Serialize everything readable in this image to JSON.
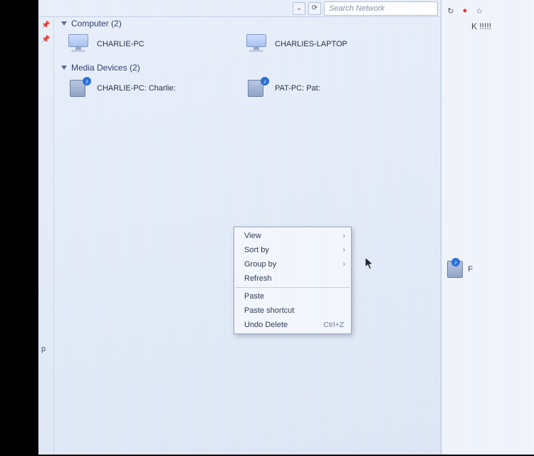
{
  "toolbar": {
    "refresh_glyph": "⟳",
    "dropdown_glyph": "⌄",
    "search_placeholder": "Search Network"
  },
  "browser_behind": {
    "reload_glyph": "↻",
    "adblock_glyph": "●",
    "star_glyph": "☆",
    "tab_tail_text": "K !!!!!",
    "side_letter": "F",
    "bottom_letter": "p"
  },
  "groups": [
    {
      "label": "Computer (2)",
      "items": [
        {
          "name": "CHARLIE-PC",
          "icon": "pc"
        },
        {
          "name": "CHARLIES-LAPTOP",
          "icon": "pc"
        }
      ]
    },
    {
      "label": "Media Devices (2)",
      "items": [
        {
          "name": "CHARLIE-PC: Charlie:",
          "icon": "dev"
        },
        {
          "name": "PAT-PC: Pat:",
          "icon": "dev"
        }
      ]
    }
  ],
  "context_menu": {
    "view": "View",
    "sort_by": "Sort by",
    "group_by": "Group by",
    "refresh": "Refresh",
    "paste": "Paste",
    "paste_shortcut": "Paste shortcut",
    "undo_delete": "Undo Delete",
    "undo_shortcut": "Ctrl+Z"
  }
}
